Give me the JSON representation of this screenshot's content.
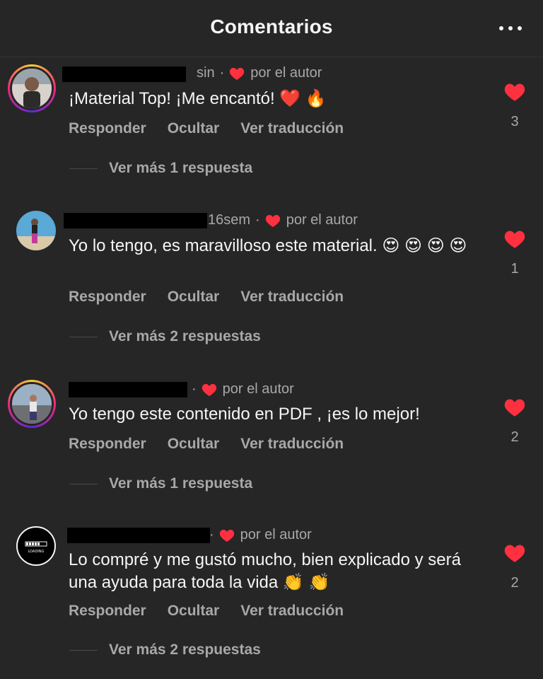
{
  "header": {
    "title": "Comentarios"
  },
  "comments": [
    {
      "time": "sin",
      "author_like": "por el autor",
      "text": "¡Material Top! ¡Me encantó! ❤️ 🔥",
      "actions": [
        "Responder",
        "Ocultar",
        "Ver traducción"
      ],
      "view_more": "Ver más 1 respuesta",
      "likes": "3"
    },
    {
      "time": "16sem",
      "author_like": "por el autor",
      "text": "Yo lo tengo, es maravilloso este material. 😍 😍 😍 😍",
      "actions": [
        "Responder",
        "Ocultar",
        "Ver traducción"
      ],
      "view_more": "Ver más 2 respuestas",
      "likes": "1"
    },
    {
      "time": "",
      "author_like": "por el autor",
      "text": "Yo tengo este contenido en PDF , ¡es lo mejor!",
      "actions": [
        "Responder",
        "Ocultar",
        "Ver traducción"
      ],
      "view_more": "Ver más 1 respuesta",
      "likes": "2"
    },
    {
      "time": "",
      "author_like": "por el autor",
      "text": "Lo compré y me gustó mucho, bien explicado y será una ayuda para toda la vida 👏 👏",
      "avatar_label": "LOADING",
      "actions": [
        "Responder",
        "Ocultar",
        "Ver traducción"
      ],
      "view_more": "Ver más 2 respuestas",
      "likes": "2"
    }
  ],
  "colors": {
    "background": "#262626",
    "heart": "#ff3040",
    "muted_text": "#a8a8a8"
  },
  "icons": [
    "more-horizontal-icon",
    "heart-icon"
  ]
}
